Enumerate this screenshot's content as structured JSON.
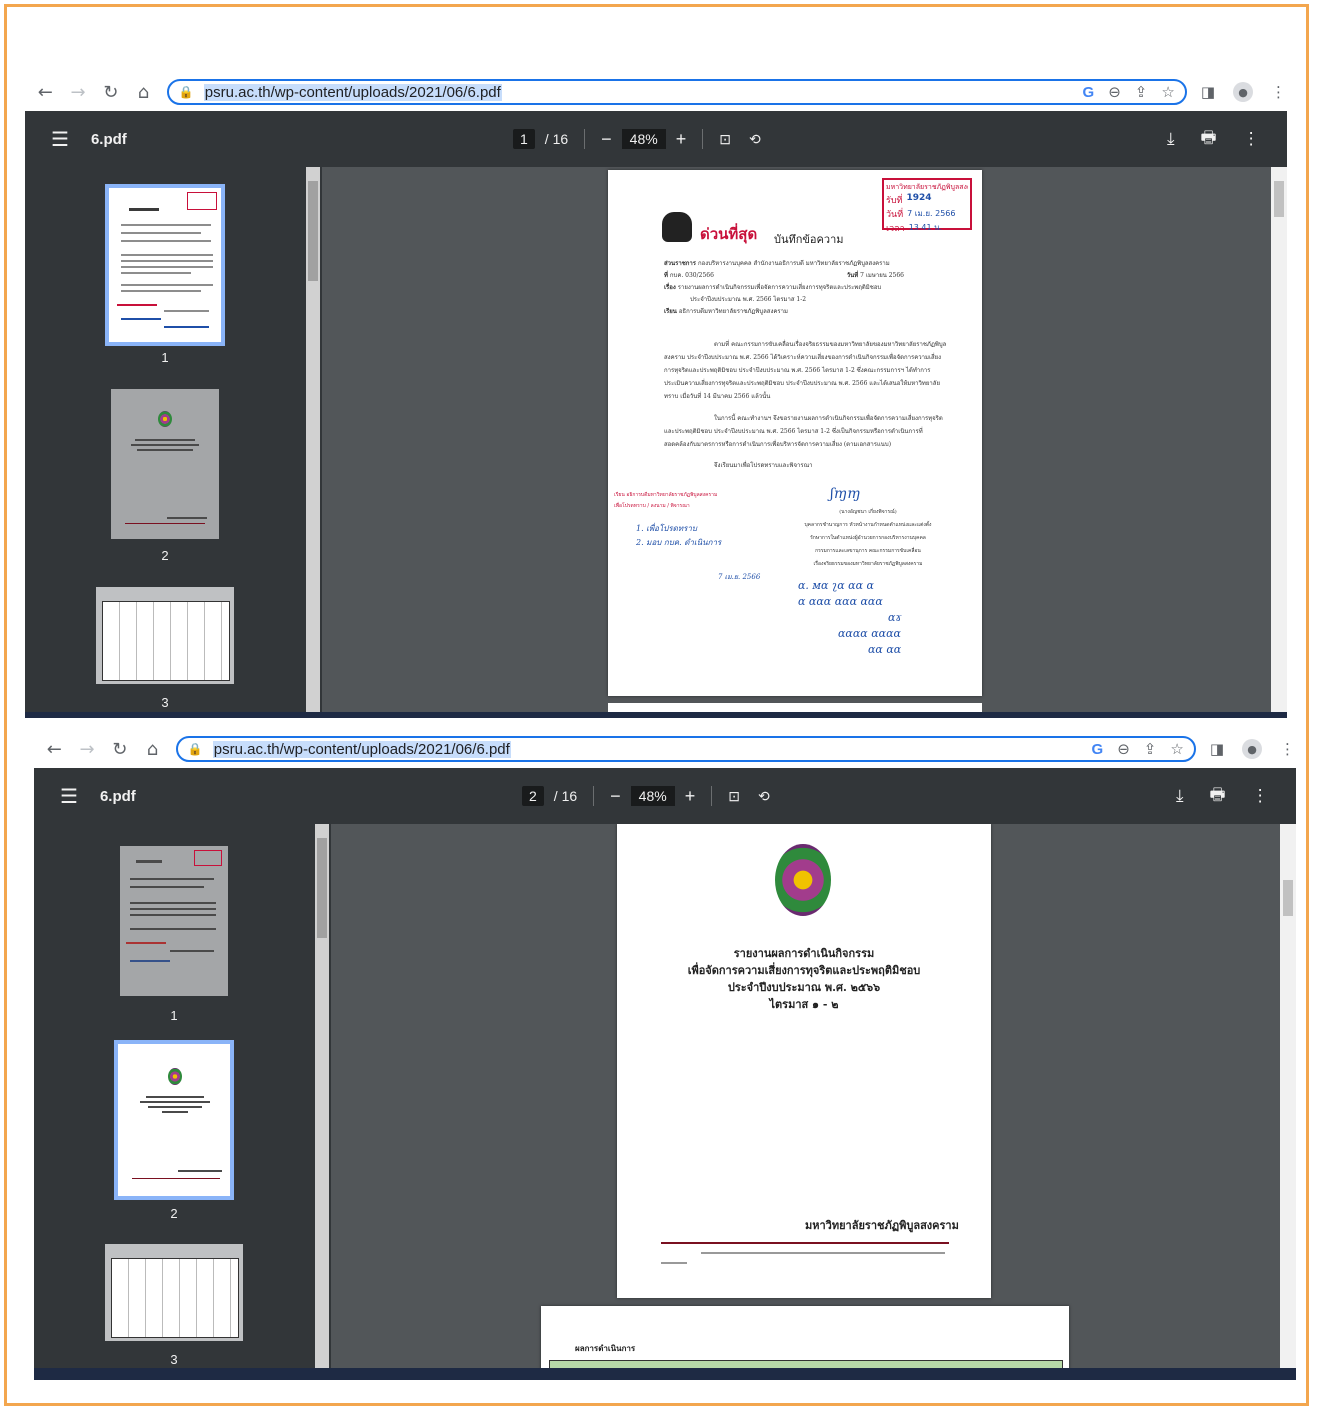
{
  "browser": {
    "url": "psru.ac.th/wp-content/uploads/2021/06/6.pdf"
  },
  "viewer": {
    "file_name": "6.pdf",
    "total_pages": "/ 16",
    "zoom": "48%"
  },
  "top_shot": {
    "current_page": "1",
    "thumbnails": [
      "1",
      "2",
      "3"
    ]
  },
  "bottom_shot": {
    "current_page": "2",
    "thumbnails": [
      "1",
      "2",
      "3"
    ]
  },
  "pdf_page1": {
    "urgent": "ด่วนที่สุด",
    "memo_title": "บันทึกข้อความ",
    "agency_label": "ส่วนราชการ",
    "agency": "กองบริหารงานบุคคล สำนักงานอธิการบดี มหาวิทยาลัยราชภัฏพิบูลสงคราม",
    "ref_label": "ที่",
    "ref": "กบค. 030/2566",
    "date_label": "วันที่",
    "date": "7 เมษายน 2566",
    "subject_label": "เรื่อง",
    "subject": "รายงานผลการดำเนินกิจกรรมเพื่อจัดการความเสี่ยงการทุจริตและประพฤติมิชอบ",
    "subject2": "ประจำปีงบประมาณ พ.ศ. 2566 ไตรมาส 1-2",
    "to_label": "เรียน",
    "to": "อธิการบดีมหาวิทยาลัยราชภัฏพิบูลสงคราม",
    "stamp_line1": "มหาวิทยาลัยราชภัฏพิบูลสงคราม",
    "stamp_num": "1924",
    "stamp_date": "7 เม.ย. 2566",
    "stamp_time": "13.41 น.",
    "stamp_l2": "รับที่",
    "stamp_l3": "วันที่",
    "stamp_l4": "เวลา",
    "body1": "ตามที่ คณะกรรมการขับเคลื่อนเรื่องจริยธรรมของมหาวิทยาลัยของมหาวิทยาลัยราชภัฏพิบูลสงคราม ประจำปีงบประมาณ พ.ศ. 2566 ได้วิเคราะห์ความเสี่ยงของการดำเนินกิจกรรมเพื่อจัดการความเสี่ยงการทุจริตและประพฤติมิชอบ ประจำปีงบประมาณ พ.ศ. 2566 ไตรมาส 1-2 ซึ่งคณะกรรมการฯ ได้ทำการประเมินความเสี่ยงการทุจริตและประพฤติมิชอบ ประจำปีงบประมาณ พ.ศ. 2566 และได้เสนอให้มหาวิทยาลัยทราบ เมื่อวันที่ 14 มีนาคม 2566 แล้วนั้น",
    "body2": "ในการนี้ คณะทำงานฯ จึงขอรายงานผลการดำเนินกิจกรรมเพื่อจัดการความเสี่ยงการทุจริตและประพฤติมิชอบ ประจำปีงบประมาณ พ.ศ. 2566 ไตรมาส 1-2 ซึ่งเป็นกิจกรรมหรือการดำเนินการที่สอดคล้องกับมาตรการหรือการดำเนินการเพื่อบริหารจัดการความเสี่ยง (ตามเอกสารแนบ)",
    "body3": "จึงเรียนมาเพื่อโปรดทราบและพิจารณา",
    "sig_name": "(นางอัญชนา เกี่ยงพิจารณ์)",
    "sig_role1": "บุคลากรชำนาญการ หัวหน้างานกำหนดตำแหน่งและแต่งตั้ง",
    "sig_role2": "รักษาการในตำแหน่งผู้อำนวยการกองบริหารงานบุคคล",
    "sig_role3": "กรรมการและเลขานุการ คณะกรรมการขับเคลื่อน",
    "sig_role4": "เรื่องจริยธรรมของมหาวิทยาลัยราชภัฏพิบูลสงคราม",
    "red_note": "เรียน อธิการบดีมหาวิทยาลัยราชภัฏพิบูลสงคราม",
    "red_note2": "เพื่อโปรดทราบ / ลงนาม / พิจารณา",
    "blue_item1": "1. เพื่อโปรดทราบ",
    "blue_item2": "2. มอบ กบค. ดำเนินการ",
    "blue_date": "7 เม.ย. 2566"
  },
  "pdf_page2": {
    "title1": "รายงานผลการดำเนินกิจกรรม",
    "title2": "เพื่อจัดการความเสี่ยงการทุจริตและประพฤติมิชอบ",
    "title3": "ประจำปีงบประมาณ พ.ศ. ๒๕๖๖",
    "title4": "ไตรมาส ๑ - ๒",
    "university": "มหาวิทยาลัยราชภัฏพิบูลสงคราม",
    "page3_header": "ผลการดำเนินการ"
  }
}
